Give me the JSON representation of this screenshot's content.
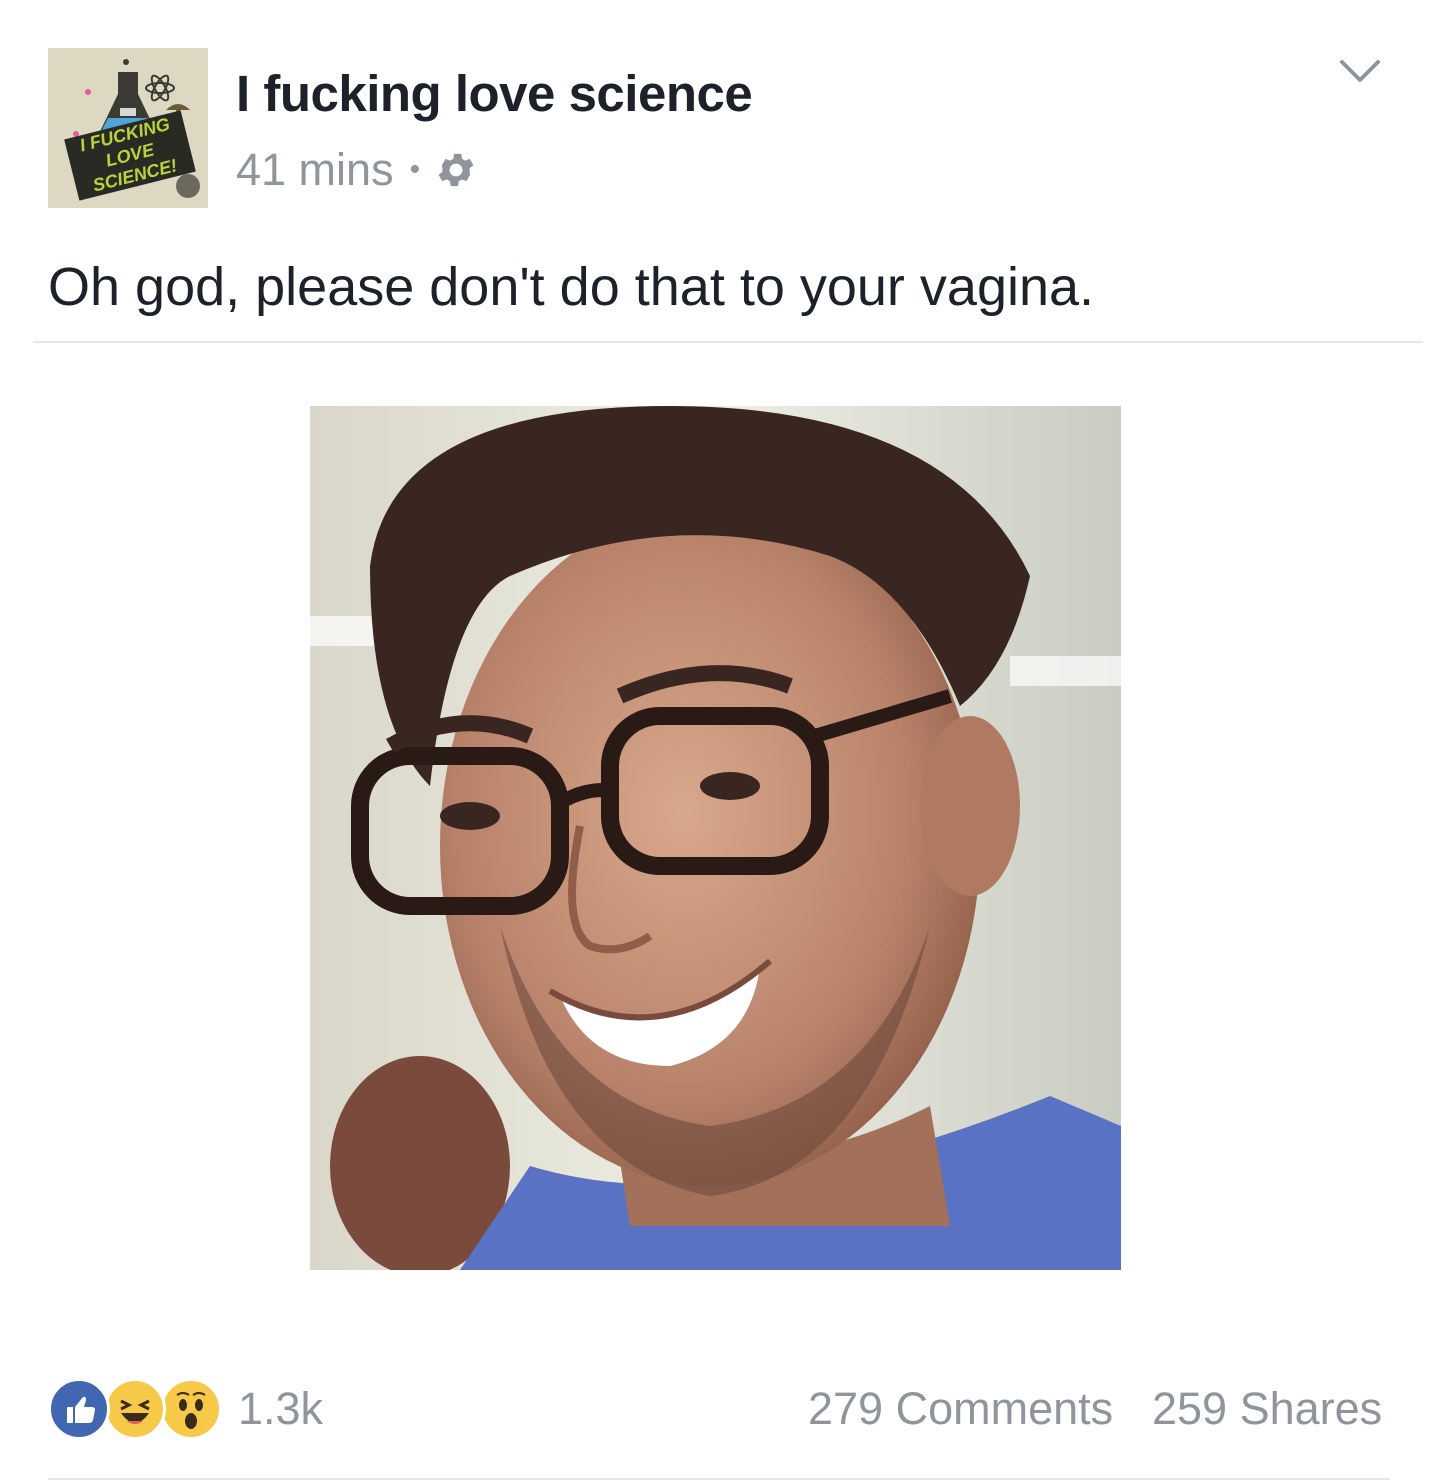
{
  "post": {
    "author": {
      "name": "I fucking love science",
      "avatar_icon": "science-flask-logo",
      "avatar_logo_text": "I FUCKING LOVE SCIENCE!"
    },
    "timestamp": "41 mins",
    "separator": "•",
    "privacy_icon": "gear-icon",
    "menu_icon": "chevron-down-icon",
    "text": "Oh god, please don't do that to your vagina.",
    "image_description_icon": "photo"
  },
  "footer": {
    "reactions": [
      {
        "type": "like",
        "icon": "thumbs-up-icon",
        "color": "#4267b2"
      },
      {
        "type": "haha",
        "icon": "laughing-face-icon",
        "color": "#f7c948"
      },
      {
        "type": "wow",
        "icon": "surprised-face-icon",
        "color": "#f7c948"
      }
    ],
    "reaction_count": "1.3k",
    "comments": "279 Comments",
    "shares": "259 Shares"
  },
  "colors": {
    "text_primary": "#1d2129",
    "text_secondary": "#90949c",
    "divider": "#e5e6e9",
    "like_blue": "#4267b2"
  }
}
